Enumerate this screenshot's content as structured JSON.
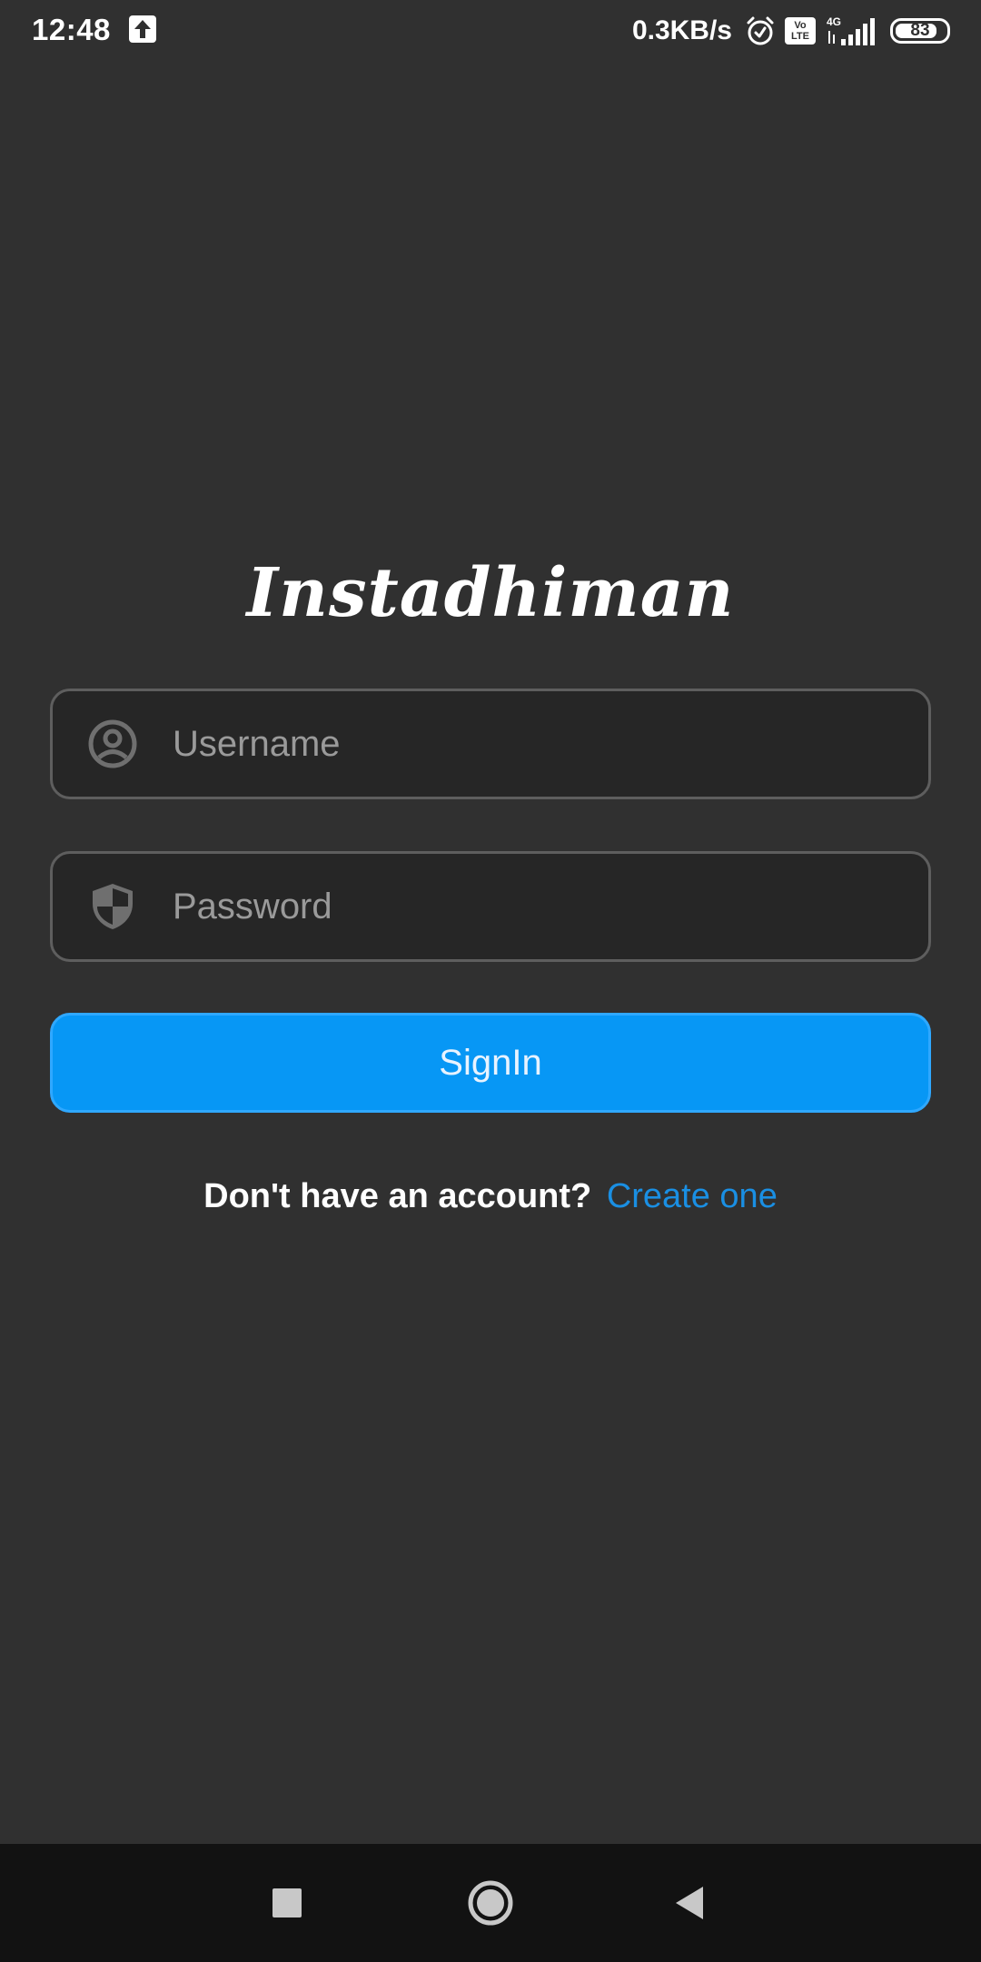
{
  "status_bar": {
    "time": "12:48",
    "net_speed": "0.3KB/s",
    "volte_top": "Vo",
    "volte_bottom": "LTE",
    "network_type": "4G",
    "battery_level": "83",
    "battery_percent": 83,
    "icons": [
      "upload-icon",
      "alarm-icon",
      "volte-icon",
      "signal-icon",
      "battery-icon"
    ]
  },
  "logo": {
    "text": "Instadhiman"
  },
  "login_form": {
    "username": {
      "placeholder": "Username",
      "value": "",
      "icon": "account-circle-icon"
    },
    "password": {
      "placeholder": "Password",
      "value": "",
      "icon": "shield-icon"
    },
    "signin_label": "SignIn"
  },
  "signup": {
    "prompt": "Don't have an account?",
    "link_label": "Create one"
  },
  "nav_bar": {
    "icons": [
      "recents-square-icon",
      "home-circle-icon",
      "back-triangle-icon"
    ]
  },
  "colors": {
    "background": "#303030",
    "field_background": "#262626",
    "field_border": "#5e5e5e",
    "accent": "#0797f5",
    "link": "#1a8fe3",
    "nav_background": "#121212"
  }
}
